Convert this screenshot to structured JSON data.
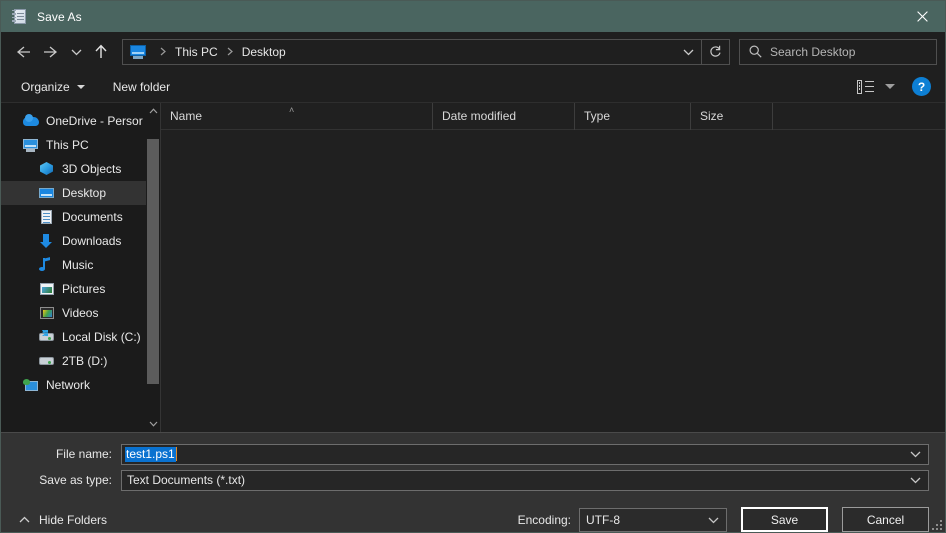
{
  "window": {
    "title": "Save As",
    "icon": "notepad-icon",
    "close_label": "✕",
    "titlebar_color": "#4a6560"
  },
  "addressbar": {
    "back_icon": "back-arrow-icon",
    "forward_icon": "forward-arrow-icon",
    "recent_icon": "chevron-down-icon",
    "up_icon": "up-arrow-icon",
    "crumb_icon": "this-pc-icon",
    "crumbs": [
      "This PC",
      "Desktop"
    ],
    "dropdown_icon": "chevron-down-icon",
    "refresh_icon": "refresh-icon",
    "refresh_glyph": "↻"
  },
  "search": {
    "placeholder": "Search Desktop",
    "icon": "search-icon"
  },
  "toolbar": {
    "organize_label": "Organize",
    "new_folder_label": "New folder",
    "view_icon": "list-view-icon",
    "view_dropdown_icon": "chevron-down-icon",
    "help_label": "?",
    "help_icon": "help-icon",
    "help_color": "#0d7fd4"
  },
  "sidebar": {
    "items": [
      {
        "label": "OneDrive - Persor",
        "icon": "onedrive-icon",
        "indent": false,
        "selected": false
      },
      {
        "label": "This PC",
        "icon": "this-pc-icon",
        "indent": false,
        "selected": false
      },
      {
        "label": "3D Objects",
        "icon": "3d-objects-icon",
        "indent": true,
        "selected": false
      },
      {
        "label": "Desktop",
        "icon": "desktop-icon",
        "indent": true,
        "selected": true
      },
      {
        "label": "Documents",
        "icon": "documents-icon",
        "indent": true,
        "selected": false
      },
      {
        "label": "Downloads",
        "icon": "downloads-icon",
        "indent": true,
        "selected": false
      },
      {
        "label": "Music",
        "icon": "music-icon",
        "indent": true,
        "selected": false
      },
      {
        "label": "Pictures",
        "icon": "pictures-icon",
        "indent": true,
        "selected": false
      },
      {
        "label": "Videos",
        "icon": "videos-icon",
        "indent": true,
        "selected": false
      },
      {
        "label": "Local Disk (C:)",
        "icon": "local-disk-icon",
        "indent": true,
        "selected": false
      },
      {
        "label": "2TB (D:)",
        "icon": "drive-icon",
        "indent": true,
        "selected": false
      },
      {
        "label": "Network",
        "icon": "network-icon",
        "indent": false,
        "selected": false
      }
    ],
    "scroll_up_icon": "chevron-up-icon",
    "scroll_down_icon": "chevron-down-icon"
  },
  "filelist": {
    "columns": [
      {
        "label": "Name",
        "sorted": true,
        "sort_indicator": "˄"
      },
      {
        "label": "Date modified",
        "sorted": false,
        "sort_indicator": ""
      },
      {
        "label": "Type",
        "sorted": false,
        "sort_indicator": ""
      },
      {
        "label": "Size",
        "sorted": false,
        "sort_indicator": ""
      }
    ],
    "rows": []
  },
  "form": {
    "filename_label": "File name:",
    "filename_value": "test1.ps1",
    "filename_selected": true,
    "selection_color": "#0a72d0",
    "savetype_label": "Save as type:",
    "savetype_value": "Text Documents (*.txt)",
    "dropdown_icon": "chevron-down-icon"
  },
  "footer": {
    "hide_folders_label": "Hide Folders",
    "hide_folders_icon": "chevron-up-icon",
    "encoding_label": "Encoding:",
    "encoding_value": "UTF-8",
    "encoding_dropdown_icon": "chevron-down-icon",
    "save_label": "Save",
    "cancel_label": "Cancel",
    "resize_grip_icon": "resize-grip-icon"
  }
}
